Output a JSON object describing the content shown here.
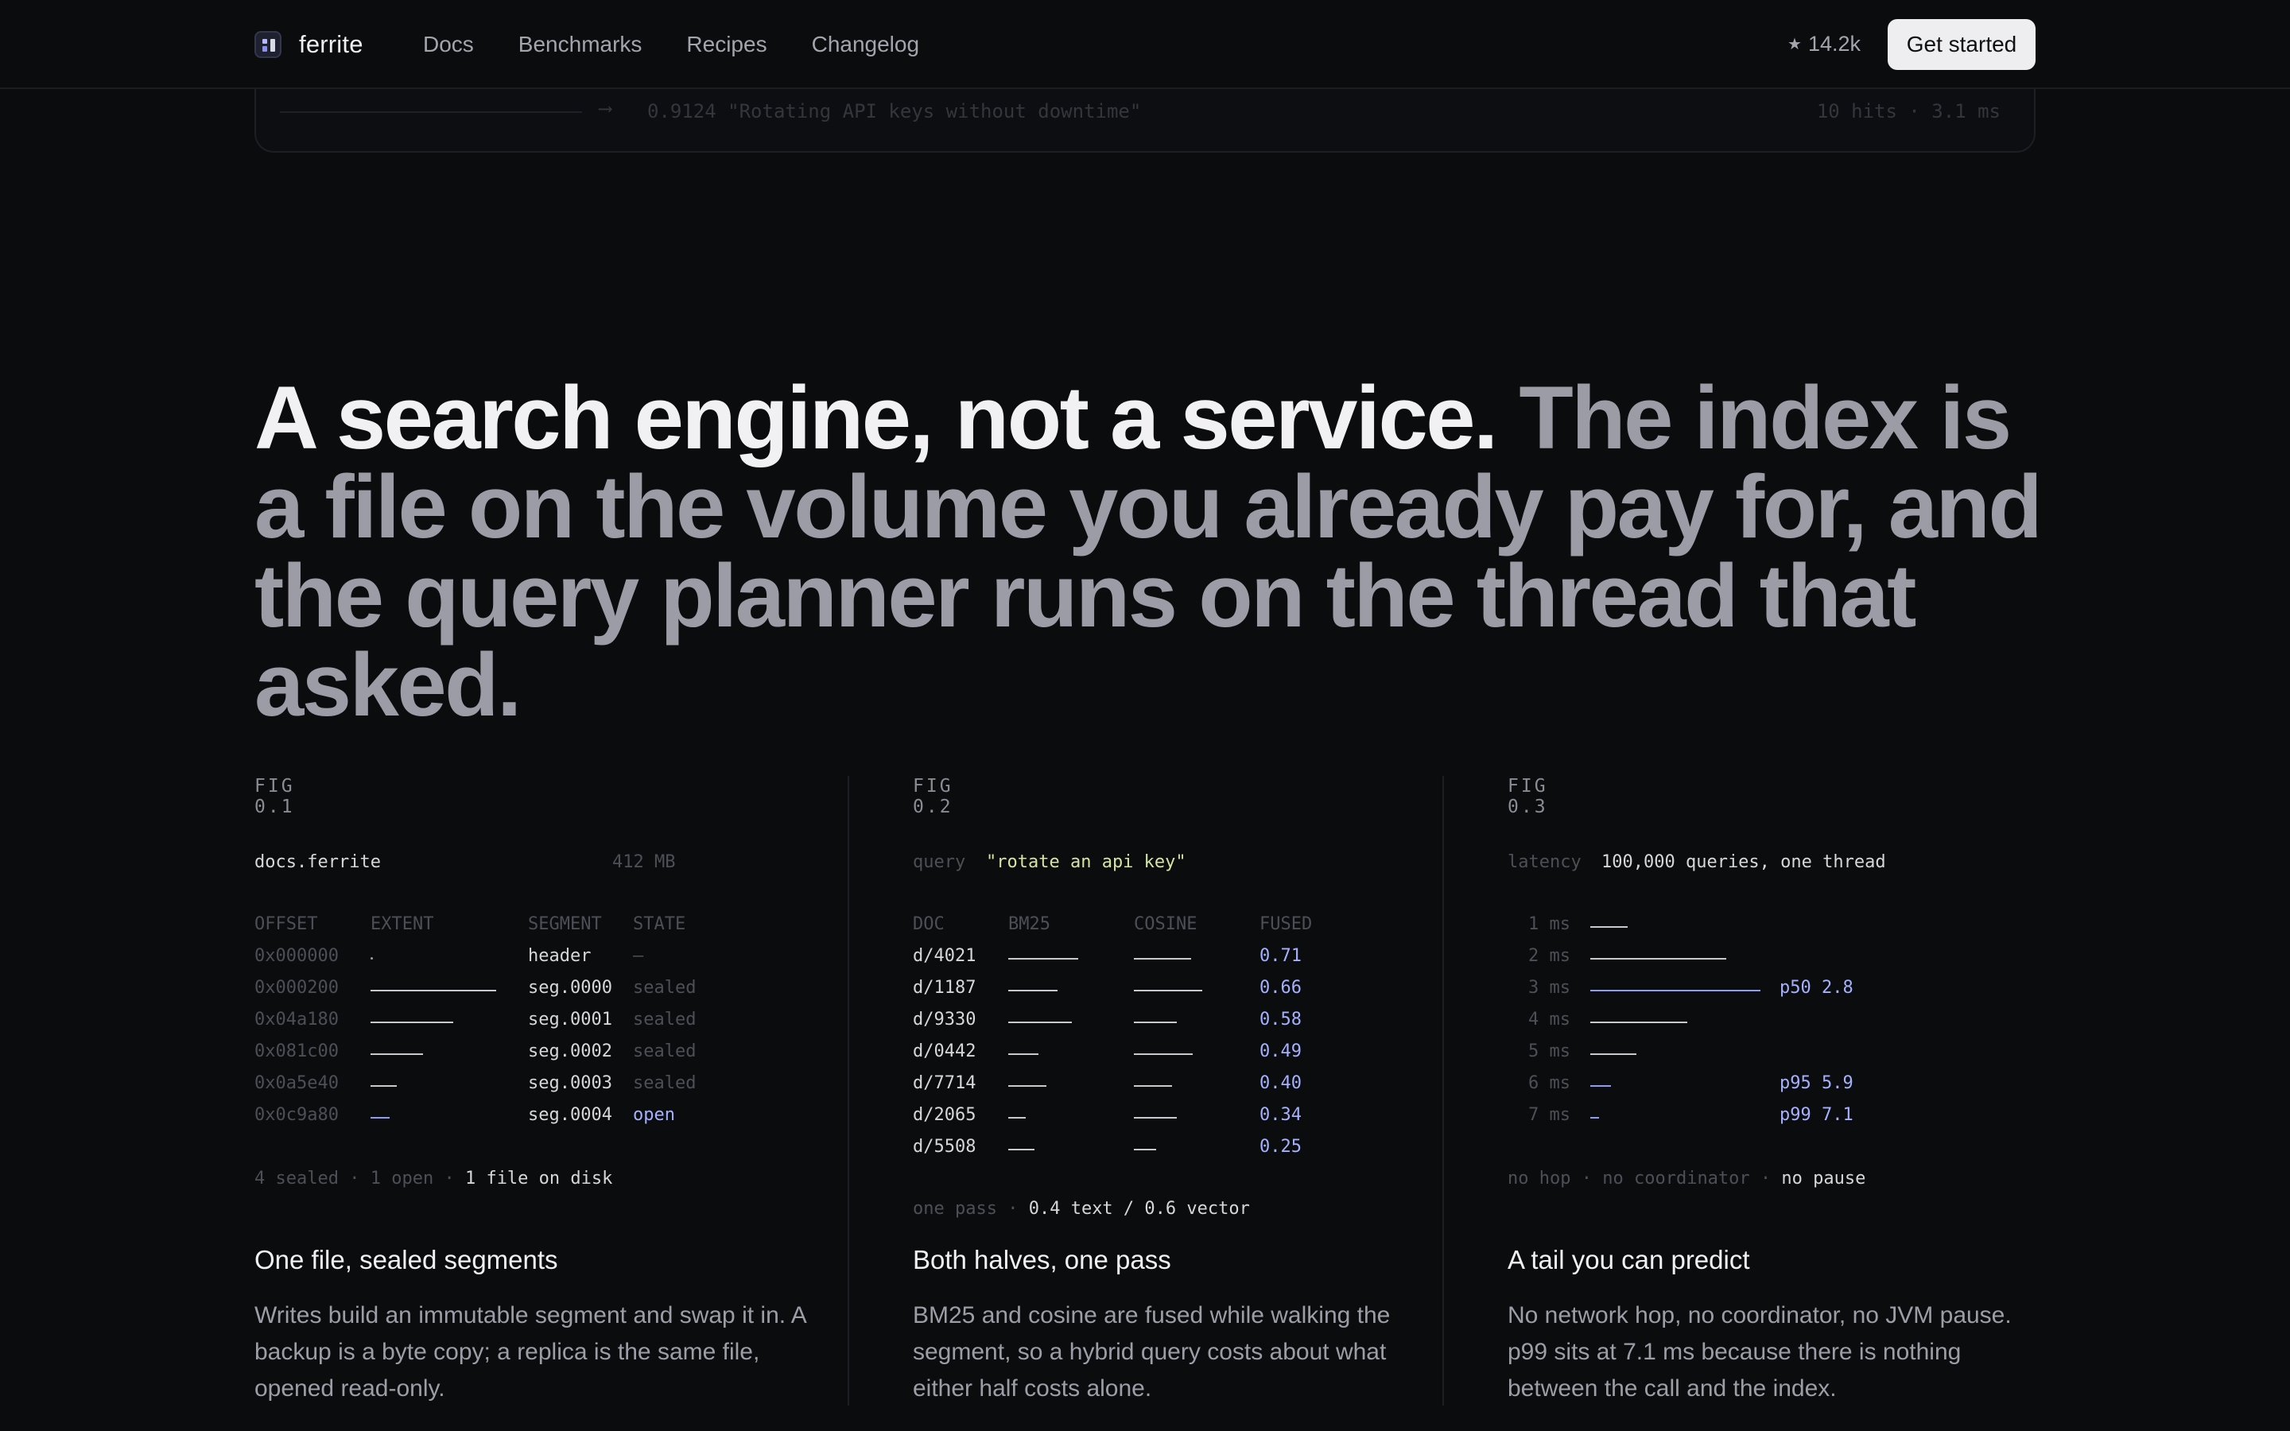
{
  "nav": {
    "brand": "ferrite",
    "links": [
      "Docs",
      "Benchmarks",
      "Recipes",
      "Changelog"
    ],
    "stars_icon": "star-icon",
    "stars": "14.2k",
    "cta": "Get started"
  },
  "ghost": {
    "arrow": "⟶",
    "result": "0.9124 \"Rotating API keys without downtime\"",
    "meta": "10 hits · 3.1 ms"
  },
  "hero": {
    "lead": "A search engine, not a service.",
    "rest": " The index is a file on the volume you already pay for, and the query planner runs on the thread that asked."
  },
  "fig1": {
    "label": "FIG 0.1",
    "file": "docs.ferrite",
    "size": "412 MB",
    "headers": [
      "OFFSET",
      "EXTENT",
      "SEGMENT",
      "STATE"
    ],
    "rows": [
      {
        "offset": "0x000000",
        "extent": 0,
        "segment": "header",
        "state": "–"
      },
      {
        "offset": "0x000200",
        "extent": 1.0,
        "segment": "seg.0000",
        "state": "sealed"
      },
      {
        "offset": "0x04a180",
        "extent": 0.66,
        "segment": "seg.0001",
        "state": "sealed"
      },
      {
        "offset": "0x081c00",
        "extent": 0.42,
        "segment": "seg.0002",
        "state": "sealed"
      },
      {
        "offset": "0x0a5e40",
        "extent": 0.21,
        "segment": "seg.0003",
        "state": "sealed"
      },
      {
        "offset": "0x0c9a80",
        "extent": 0.15,
        "segment": "seg.0004",
        "state": "open"
      }
    ],
    "footer": {
      "a": "4 sealed",
      "sep": " · ",
      "b": "1 open",
      "c": "1 file on disk"
    },
    "title": "One file, sealed segments",
    "desc": "Writes build an immutable segment and swap it in. A backup is a byte copy; a replica is the same file, opened read-only."
  },
  "fig2": {
    "label": "FIG 0.2",
    "query_label": "query",
    "query": "\"rotate an api key\"",
    "headers": [
      "DOC",
      "BM25",
      "COSINE",
      "FUSED"
    ],
    "rows": [
      {
        "doc": "d/4021",
        "bm25": 0.88,
        "cosine": 0.72,
        "fused": "0.71"
      },
      {
        "doc": "d/1187",
        "bm25": 0.62,
        "cosine": 0.86,
        "fused": "0.66"
      },
      {
        "doc": "d/9330",
        "bm25": 0.8,
        "cosine": 0.54,
        "fused": "0.58"
      },
      {
        "doc": "d/0442",
        "bm25": 0.38,
        "cosine": 0.74,
        "fused": "0.49"
      },
      {
        "doc": "d/7714",
        "bm25": 0.48,
        "cosine": 0.48,
        "fused": "0.40"
      },
      {
        "doc": "d/2065",
        "bm25": 0.22,
        "cosine": 0.54,
        "fused": "0.34"
      },
      {
        "doc": "d/5508",
        "bm25": 0.33,
        "cosine": 0.28,
        "fused": "0.25"
      }
    ],
    "footer": {
      "a": "one pass",
      "sep": " · ",
      "b": "0.4 text / 0.6 vector"
    },
    "title": "Both halves, one pass",
    "desc": "BM25 and cosine are fused while walking the segment, so a hybrid query costs about what either half costs alone."
  },
  "fig3": {
    "label": "FIG 0.3",
    "latency_label": "latency",
    "latency": "100,000 queries, one thread",
    "rows": [
      {
        "ms": "1 ms",
        "value": 0.22,
        "accent": false,
        "mark": ""
      },
      {
        "ms": "2 ms",
        "value": 0.8,
        "accent": false,
        "mark": ""
      },
      {
        "ms": "3 ms",
        "value": 1.0,
        "accent": true,
        "mark": "p50 2.8"
      },
      {
        "ms": "4 ms",
        "value": 0.57,
        "accent": false,
        "mark": ""
      },
      {
        "ms": "5 ms",
        "value": 0.27,
        "accent": false,
        "mark": ""
      },
      {
        "ms": "6 ms",
        "value": 0.12,
        "accent": true,
        "mark": "p95 5.9"
      },
      {
        "ms": "7 ms",
        "value": 0.05,
        "accent": true,
        "mark": "p99 7.1"
      }
    ],
    "footer": {
      "a": "no hop",
      "sep": " · ",
      "b": "no coordinator",
      "c": "no pause"
    },
    "title": "A tail you can predict",
    "desc": "No network hop, no coordinator, no JVM pause. p99 sits at 7.1 ms because there is nothing between the call and the index."
  }
}
